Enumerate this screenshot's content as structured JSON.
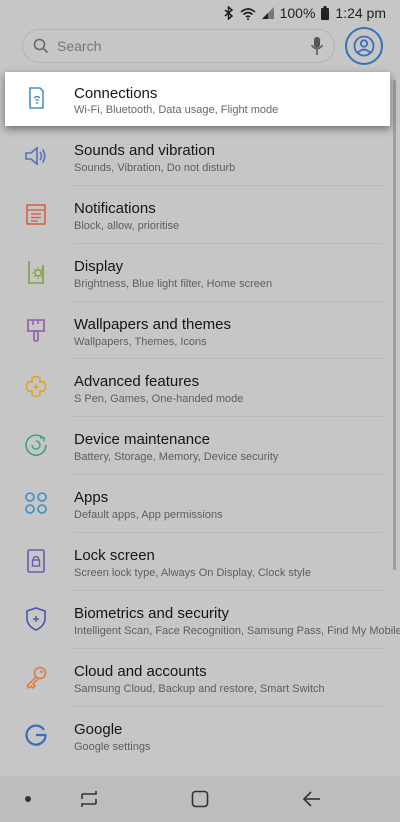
{
  "status_bar": {
    "battery_percent": "100%",
    "time": "1:24 pm",
    "icons": [
      "bluetooth-icon",
      "wifi-icon",
      "signal-icon",
      "battery-icon"
    ]
  },
  "search": {
    "placeholder": "Search",
    "mic_icon": "mic-icon",
    "account_icon": "account-icon"
  },
  "settings": [
    {
      "title": "Connections",
      "subtitle": "Wi-Fi, Bluetooth, Data usage, Flight mode",
      "icon": "connections-icon",
      "color": "#4a8fcf"
    },
    {
      "title": "Sounds and vibration",
      "subtitle": "Sounds, Vibration, Do not disturb",
      "icon": "speaker-icon",
      "color": "#5b6fb8"
    },
    {
      "title": "Notifications",
      "subtitle": "Block, allow, prioritise",
      "icon": "notifications-icon",
      "color": "#d9604a"
    },
    {
      "title": "Display",
      "subtitle": "Brightness, Blue light filter, Home screen",
      "icon": "display-icon",
      "color": "#7aa43a"
    },
    {
      "title": "Wallpapers and themes",
      "subtitle": "Wallpapers, Themes, Icons",
      "icon": "brush-icon",
      "color": "#8d5ca6"
    },
    {
      "title": "Advanced features",
      "subtitle": "S Pen, Games, One-handed mode",
      "icon": "puzzle-icon",
      "color": "#e0a42a"
    },
    {
      "title": "Device maintenance",
      "subtitle": "Battery, Storage, Memory, Device security",
      "icon": "maintenance-icon",
      "color": "#3aa38a"
    },
    {
      "title": "Apps",
      "subtitle": "Default apps, App permissions",
      "icon": "apps-icon",
      "color": "#3d8dc4"
    },
    {
      "title": "Lock screen",
      "subtitle": "Screen lock type, Always On Display, Clock style",
      "icon": "lock-icon",
      "color": "#6a5bb0"
    },
    {
      "title": "Biometrics and security",
      "subtitle": "Intelligent Scan, Face Recognition, Samsung Pass, Find My Mobile",
      "icon": "shield-icon",
      "color": "#4a5aa0"
    },
    {
      "title": "Cloud and accounts",
      "subtitle": "Samsung Cloud, Backup and restore, Smart Switch",
      "icon": "key-icon",
      "color": "#e07a3a"
    },
    {
      "title": "Google",
      "subtitle": "Google settings",
      "icon": "google-icon",
      "color": "#3a6cc0"
    }
  ],
  "nav": {
    "dot": "nav-dot-icon",
    "recents": "recents-icon",
    "home": "home-icon",
    "back": "back-icon"
  },
  "colors": {
    "dim_background": "#c6c6c6",
    "highlight_card": "#ffffff",
    "accent": "#3a70b8"
  }
}
